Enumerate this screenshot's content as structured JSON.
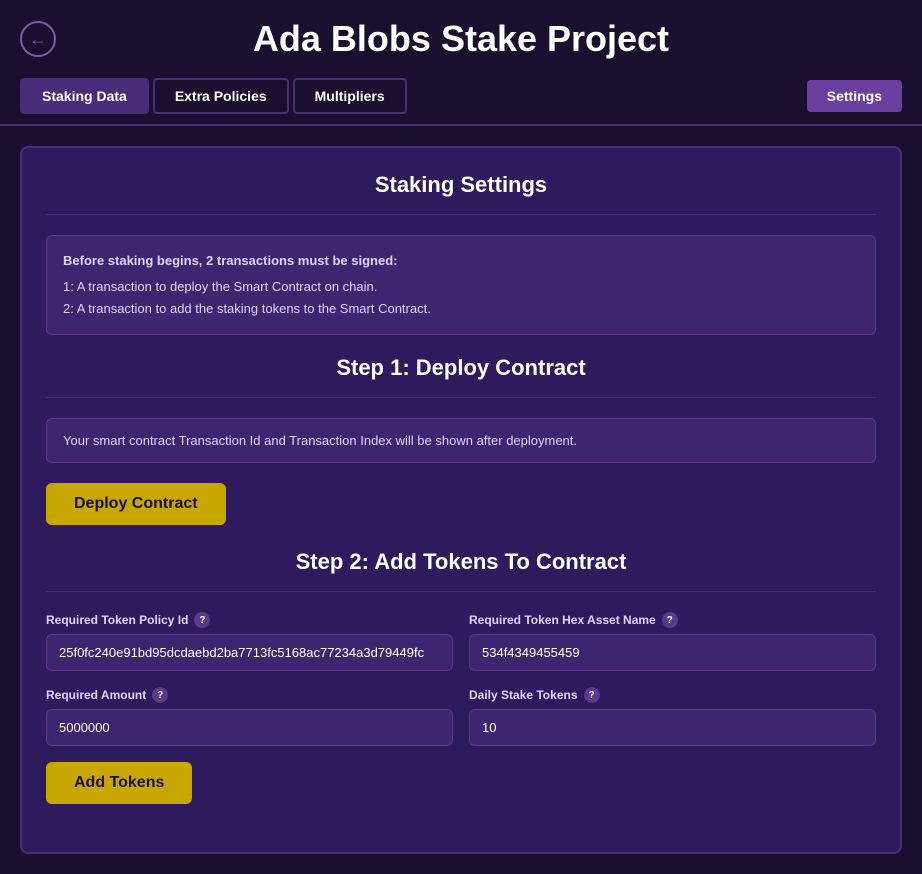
{
  "header": {
    "title": "Ada Blobs Stake Project",
    "back_button_label": "←"
  },
  "nav": {
    "tabs": [
      {
        "label": "Staking Data",
        "active": true
      },
      {
        "label": "Extra Policies",
        "active": false
      },
      {
        "label": "Multipliers",
        "active": false
      }
    ],
    "settings_label": "Settings"
  },
  "staking_settings": {
    "title": "Staking Settings",
    "info_title": "Before staking begins, 2 transactions must be signed:",
    "info_line1": "1: A transaction to deploy the Smart Contract on chain.",
    "info_line2": "2: A transaction to add the staking tokens to the Smart Contract."
  },
  "step1": {
    "title": "Step 1: Deploy Contract",
    "deploy_info": "Your smart contract Transaction Id and Transaction Index will be shown after deployment.",
    "deploy_button": "Deploy Contract"
  },
  "step2": {
    "title": "Step 2: Add Tokens To Contract",
    "fields": {
      "policy_id_label": "Required Token Policy Id",
      "policy_id_value": "25f0fc240e91bd95dcdaebd2ba7713fc5168ac77234a3d79449fc",
      "hex_asset_label": "Required Token Hex Asset Name",
      "hex_asset_value": "534f4349455459",
      "required_amount_label": "Required Amount",
      "required_amount_value": "5000000",
      "daily_stake_label": "Daily Stake Tokens",
      "daily_stake_value": "10"
    },
    "add_tokens_button": "Add Tokens"
  }
}
